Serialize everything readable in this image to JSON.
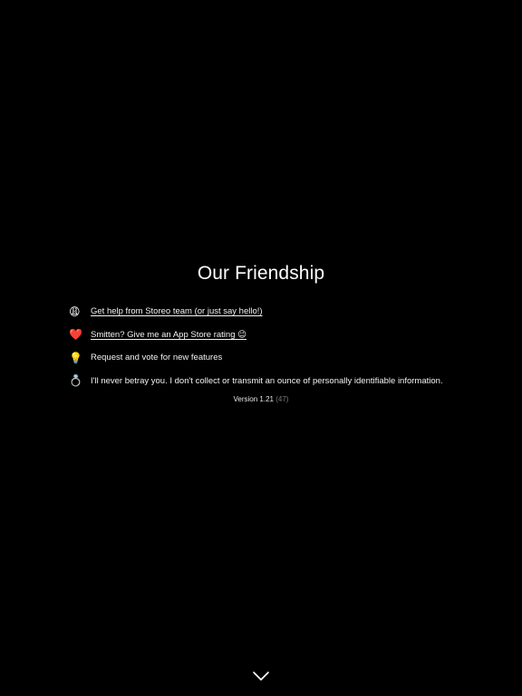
{
  "page": {
    "title": "Our Friendship"
  },
  "items": [
    {
      "icon": "weary-face-icon",
      "glyph": "😩",
      "text": "Get help from Storeo team (or just say hello!)",
      "link": true
    },
    {
      "icon": "red-heart-icon",
      "glyph": "❤️",
      "text": "Smitten? Give me an App Store rating 😉",
      "link": true
    },
    {
      "icon": "light-bulb-icon",
      "glyph": "💡",
      "text": "Request and vote for new features",
      "link": false
    },
    {
      "icon": "ring-icon",
      "glyph": "💍",
      "text": "I'll never betray you. I don't collect or transmit an ounce of personally identifiable information.",
      "link": false
    }
  ],
  "version": {
    "label": "Version 1.21",
    "build": "(47)"
  },
  "footer": {
    "icon": "chevron-down-icon"
  },
  "colors": {
    "background": "#000000",
    "text": "#ffffff",
    "muted": "#7a7a7a"
  }
}
